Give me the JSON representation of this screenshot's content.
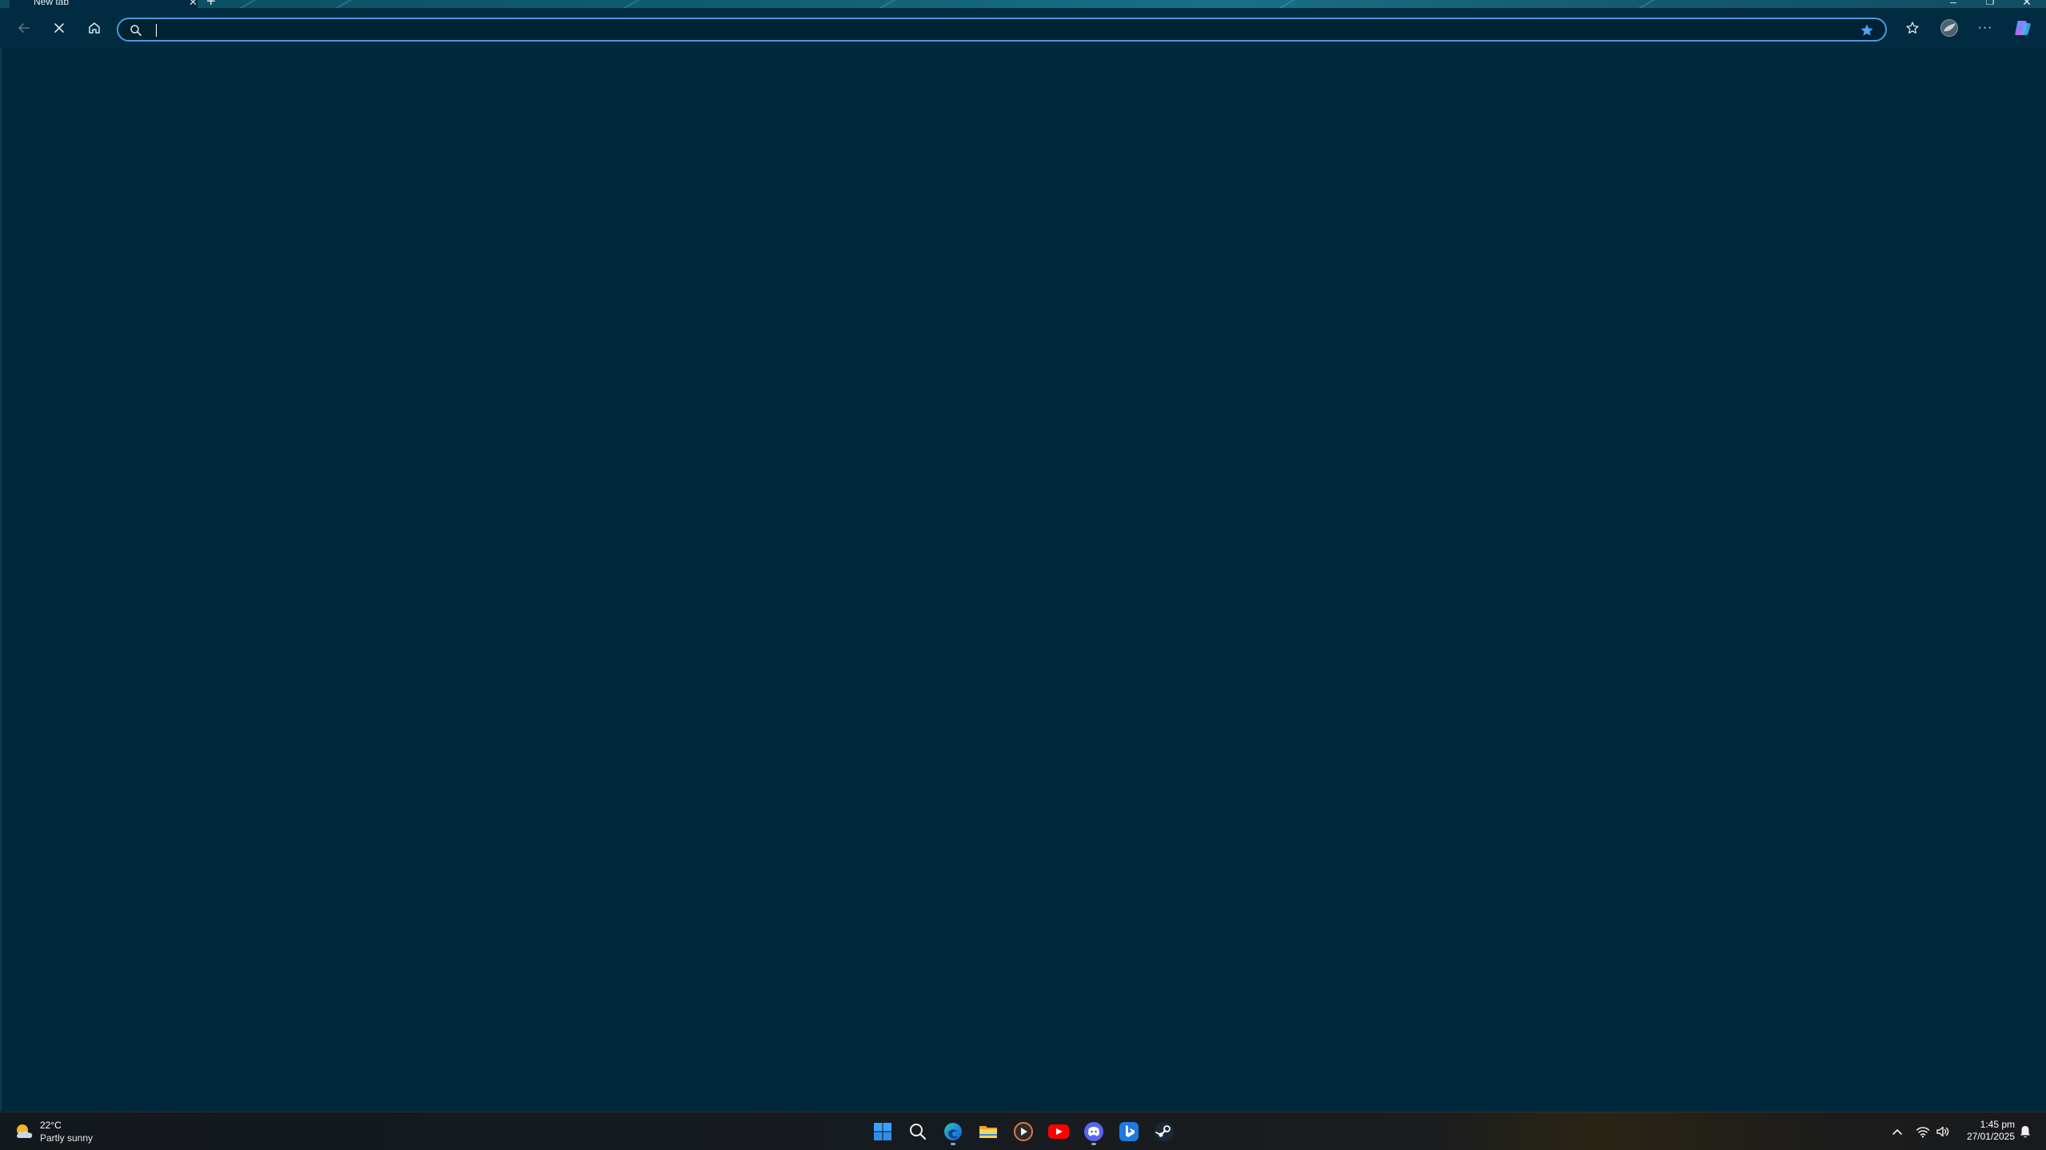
{
  "browser": {
    "tab": {
      "title": "New tab",
      "close_glyph": "✕"
    },
    "new_tab_glyph": "+",
    "window_controls": {
      "minimize": "–",
      "restore": "❐",
      "close": "✕"
    },
    "toolbar": {
      "back_icon": "arrow-left-icon",
      "stop_icon": "close-icon",
      "home_icon": "home-icon",
      "favorite_icon": "star-filled-icon",
      "favorites_icon": "star-outline-icon",
      "profile_icon": "avatar",
      "more_icon": "ellipsis-icon",
      "copilot_icon": "copilot-icon",
      "more_glyph": "···"
    },
    "address_bar": {
      "value": "",
      "placeholder": "",
      "search_icon": "search-icon"
    }
  },
  "taskbar": {
    "weather": {
      "temperature": "22°C",
      "condition": "Partly sunny"
    },
    "apps": [
      {
        "name": "Start",
        "icon": "windows-start-icon",
        "running": false
      },
      {
        "name": "Search",
        "icon": "search-icon",
        "running": false
      },
      {
        "name": "Microsoft Edge",
        "icon": "edge-icon",
        "running": true
      },
      {
        "name": "File Explorer",
        "icon": "folder-icon",
        "running": false
      },
      {
        "name": "Media Player",
        "icon": "media-player-icon",
        "running": false
      },
      {
        "name": "YouTube",
        "icon": "youtube-icon",
        "running": false
      },
      {
        "name": "Discord",
        "icon": "discord-icon",
        "running": true
      },
      {
        "name": "Bing",
        "icon": "bing-icon",
        "running": false
      },
      {
        "name": "Steam",
        "icon": "steam-icon",
        "running": false
      }
    ],
    "tray": {
      "chevron_glyph": "^",
      "time": "1:45 pm",
      "date": "27/01/2025"
    }
  },
  "colors": {
    "content_bg": "#00283d",
    "toolbar_bg": "#002b40",
    "address_border": "#4c9bdb",
    "accent_star": "#4ea3f1"
  }
}
